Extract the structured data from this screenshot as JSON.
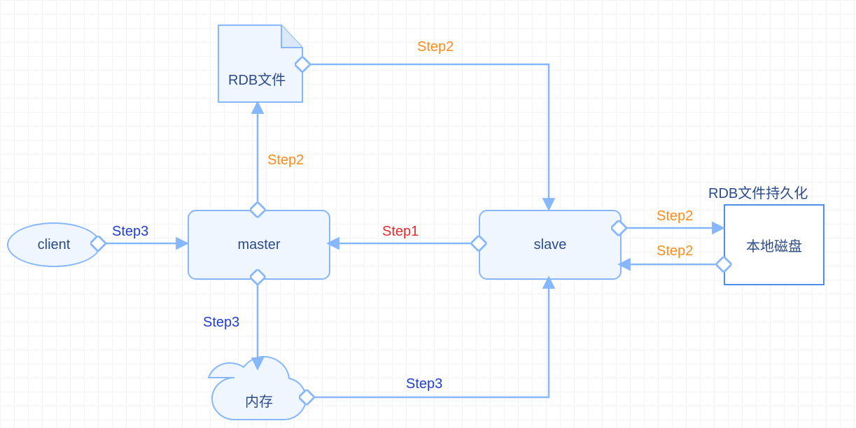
{
  "nodes": {
    "client": "client",
    "master": "master",
    "slave": "slave",
    "rdb_file": "RDB文件",
    "memory": "内存",
    "local_disk": "本地磁盘",
    "rdb_persist_title": "RDB文件持久化"
  },
  "edges": {
    "slave_to_master": {
      "label": "Step1",
      "class": "step1"
    },
    "master_to_rdb": {
      "label": "Step2",
      "class": "step2"
    },
    "rdb_to_slave": {
      "label": "Step2",
      "class": "step2"
    },
    "slave_to_disk": {
      "label": "Step2",
      "class": "step2"
    },
    "disk_to_slave": {
      "label": "Step2",
      "class": "step2"
    },
    "client_to_master": {
      "label": "Step3",
      "class": "step3"
    },
    "master_to_memory": {
      "label": "Step3",
      "class": "step3"
    },
    "memory_to_slave": {
      "label": "Step3",
      "class": "step3"
    }
  },
  "chart_data": {
    "type": "diagram",
    "title": "Redis master-slave replication flow",
    "nodes": [
      {
        "id": "client",
        "label": "client",
        "shape": "ellipse"
      },
      {
        "id": "master",
        "label": "master",
        "shape": "rounded-rect"
      },
      {
        "id": "slave",
        "label": "slave",
        "shape": "rounded-rect"
      },
      {
        "id": "rdb_file",
        "label": "RDB文件",
        "shape": "document"
      },
      {
        "id": "memory",
        "label": "内存",
        "shape": "cloud"
      },
      {
        "id": "local_disk",
        "label": "本地磁盘",
        "shape": "rect",
        "title": "RDB文件持久化"
      }
    ],
    "edges": [
      {
        "from": "slave",
        "to": "master",
        "label": "Step1",
        "color": "red"
      },
      {
        "from": "master",
        "to": "rdb_file",
        "label": "Step2",
        "color": "orange"
      },
      {
        "from": "rdb_file",
        "to": "slave",
        "label": "Step2",
        "color": "orange"
      },
      {
        "from": "slave",
        "to": "local_disk",
        "label": "Step2",
        "color": "orange"
      },
      {
        "from": "local_disk",
        "to": "slave",
        "label": "Step2",
        "color": "orange"
      },
      {
        "from": "client",
        "to": "master",
        "label": "Step3",
        "color": "blue"
      },
      {
        "from": "master",
        "to": "memory",
        "label": "Step3",
        "color": "blue"
      },
      {
        "from": "memory",
        "to": "slave",
        "label": "Step3",
        "color": "blue"
      }
    ]
  }
}
